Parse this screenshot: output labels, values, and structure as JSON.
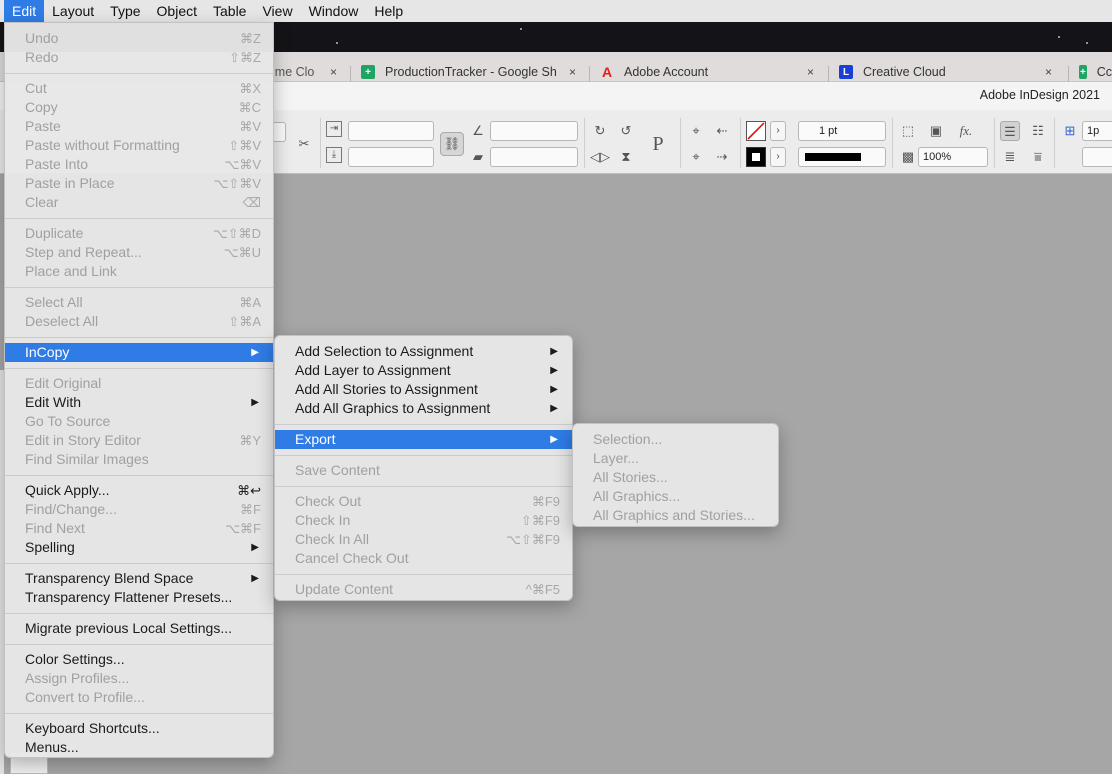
{
  "menubar": {
    "items": [
      "Edit",
      "Layout",
      "Type",
      "Object",
      "Table",
      "View",
      "Window",
      "Help"
    ],
    "active": "Edit"
  },
  "browser": {
    "tabs": [
      {
        "title": "ime Clo",
        "favicon": "google-sheets-icon"
      },
      {
        "title": "ProductionTracker - Google Sh",
        "favicon": "google-sheets-icon"
      },
      {
        "title": "Adobe Account",
        "favicon": "adobe-icon"
      },
      {
        "title": "Creative Cloud",
        "favicon": "creative-cloud-icon"
      },
      {
        "title": "Cc",
        "favicon": "google-sheets-icon"
      }
    ],
    "close_glyph": "×"
  },
  "app": {
    "title": "Adobe InDesign 2021"
  },
  "controls": {
    "stroke_weight": "1 pt",
    "opacity": "100%",
    "partial_field": "1p"
  },
  "edit_menu": {
    "groups": [
      [
        {
          "label": "Undo",
          "shortcut": "⌘Z",
          "enabled": false
        },
        {
          "label": "Redo",
          "shortcut": "⇧⌘Z",
          "enabled": false
        }
      ],
      [
        {
          "label": "Cut",
          "shortcut": "⌘X",
          "enabled": false
        },
        {
          "label": "Copy",
          "shortcut": "⌘C",
          "enabled": false
        },
        {
          "label": "Paste",
          "shortcut": "⌘V",
          "enabled": false
        },
        {
          "label": "Paste without Formatting",
          "shortcut": "⇧⌘V",
          "enabled": false
        },
        {
          "label": "Paste Into",
          "shortcut": "⌥⌘V",
          "enabled": false
        },
        {
          "label": "Paste in Place",
          "shortcut": "⌥⇧⌘V",
          "enabled": false
        },
        {
          "label": "Clear",
          "shortcut": "⌫",
          "enabled": false
        }
      ],
      [
        {
          "label": "Duplicate",
          "shortcut": "⌥⇧⌘D",
          "enabled": false
        },
        {
          "label": "Step and Repeat...",
          "shortcut": "⌥⌘U",
          "enabled": false
        },
        {
          "label": "Place and Link",
          "shortcut": "",
          "enabled": false
        }
      ],
      [
        {
          "label": "Select All",
          "shortcut": "⌘A",
          "enabled": false
        },
        {
          "label": "Deselect All",
          "shortcut": "⇧⌘A",
          "enabled": false
        }
      ],
      [
        {
          "label": "InCopy",
          "shortcut": "",
          "enabled": true,
          "submenu": true,
          "highlighted": true
        }
      ],
      [
        {
          "label": "Edit Original",
          "shortcut": "",
          "enabled": false
        },
        {
          "label": "Edit With",
          "shortcut": "",
          "enabled": true,
          "submenu": true
        },
        {
          "label": "Go To Source",
          "shortcut": "",
          "enabled": false
        },
        {
          "label": "Edit in Story Editor",
          "shortcut": "⌘Y",
          "enabled": false
        },
        {
          "label": "Find Similar Images",
          "shortcut": "",
          "enabled": false
        }
      ],
      [
        {
          "label": "Quick Apply...",
          "shortcut": "⌘↩",
          "enabled": true
        },
        {
          "label": "Find/Change...",
          "shortcut": "⌘F",
          "enabled": false
        },
        {
          "label": "Find Next",
          "shortcut": "⌥⌘F",
          "enabled": false
        },
        {
          "label": "Spelling",
          "shortcut": "",
          "enabled": true,
          "submenu": true
        }
      ],
      [
        {
          "label": "Transparency Blend Space",
          "shortcut": "",
          "enabled": true,
          "submenu": true
        },
        {
          "label": "Transparency Flattener Presets...",
          "shortcut": "",
          "enabled": true
        }
      ],
      [
        {
          "label": "Migrate previous Local Settings...",
          "shortcut": "",
          "enabled": true
        }
      ],
      [
        {
          "label": "Color Settings...",
          "shortcut": "",
          "enabled": true
        },
        {
          "label": "Assign Profiles...",
          "shortcut": "",
          "enabled": false
        },
        {
          "label": "Convert to Profile...",
          "shortcut": "",
          "enabled": false
        }
      ],
      [
        {
          "label": "Keyboard Shortcuts...",
          "shortcut": "",
          "enabled": true
        },
        {
          "label": "Menus...",
          "shortcut": "",
          "enabled": true
        }
      ]
    ]
  },
  "incopy_menu": {
    "groups": [
      [
        {
          "label": "Add Selection to Assignment",
          "shortcut": "",
          "enabled": true,
          "submenu": true
        },
        {
          "label": "Add Layer to Assignment",
          "shortcut": "",
          "enabled": true,
          "submenu": true
        },
        {
          "label": "Add All Stories to Assignment",
          "shortcut": "",
          "enabled": true,
          "submenu": true
        },
        {
          "label": "Add All Graphics to Assignment",
          "shortcut": "",
          "enabled": true,
          "submenu": true
        }
      ],
      [
        {
          "label": "Export",
          "shortcut": "",
          "enabled": true,
          "submenu": true,
          "highlighted": true
        }
      ],
      [
        {
          "label": "Save Content",
          "shortcut": "",
          "enabled": false
        }
      ],
      [
        {
          "label": "Check Out",
          "shortcut": "⌘F9",
          "enabled": false
        },
        {
          "label": "Check In",
          "shortcut": "⇧⌘F9",
          "enabled": false
        },
        {
          "label": "Check In All",
          "shortcut": "⌥⇧⌘F9",
          "enabled": false
        },
        {
          "label": "Cancel Check Out",
          "shortcut": "",
          "enabled": false
        }
      ],
      [
        {
          "label": "Update Content",
          "shortcut": "^⌘F5",
          "enabled": false
        }
      ]
    ]
  },
  "export_menu": {
    "groups": [
      [
        {
          "label": "Selection...",
          "shortcut": "",
          "enabled": false
        },
        {
          "label": "Layer...",
          "shortcut": "",
          "enabled": false
        },
        {
          "label": "All Stories...",
          "shortcut": "",
          "enabled": false
        },
        {
          "label": "All Graphics...",
          "shortcut": "",
          "enabled": false
        },
        {
          "label": "All Graphics and Stories...",
          "shortcut": "",
          "enabled": false
        }
      ]
    ]
  },
  "colors": {
    "menu_highlight": "#2f7ce6",
    "canvas": "#a6a6a6",
    "sheets_green": "#1fa463",
    "adobe_red": "#e0201b",
    "cc_blue": "#1a3fd6"
  }
}
